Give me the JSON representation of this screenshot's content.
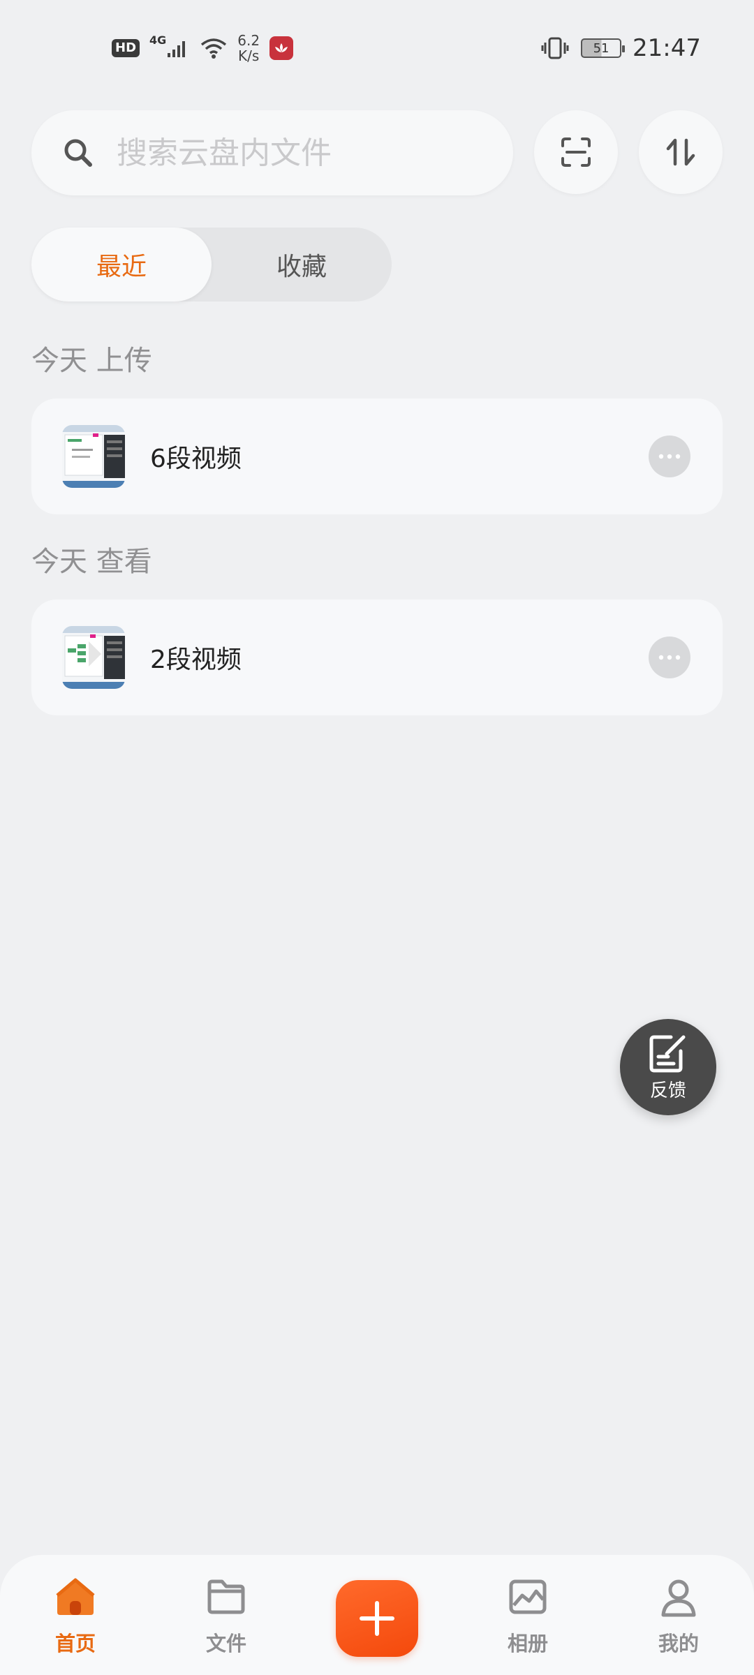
{
  "status_bar": {
    "hd": "HD",
    "network": "4G",
    "speed_value": "6.2",
    "speed_unit": "K/s",
    "battery": "51",
    "time": "21:47"
  },
  "search": {
    "placeholder": "搜索云盘内文件"
  },
  "segment": {
    "tabs": [
      {
        "label": "最近",
        "active": true
      },
      {
        "label": "收藏",
        "active": false
      }
    ]
  },
  "sections": [
    {
      "header": "今天 上传",
      "item": {
        "title": "6段视频"
      }
    },
    {
      "header": "今天 查看",
      "item": {
        "title": "2段视频"
      }
    }
  ],
  "fab": {
    "label": "反馈"
  },
  "bottom_nav": {
    "items": [
      {
        "label": "首页",
        "icon": "home-icon",
        "active": true
      },
      {
        "label": "文件",
        "icon": "folder-icon",
        "active": false
      },
      {
        "label": "相册",
        "icon": "album-icon",
        "active": false
      },
      {
        "label": "我的",
        "icon": "profile-icon",
        "active": false
      }
    ],
    "add_icon": "plus-icon"
  },
  "colors": {
    "accent": "#e86a12",
    "add_button": "#f4490c",
    "background": "#eff0f2"
  }
}
